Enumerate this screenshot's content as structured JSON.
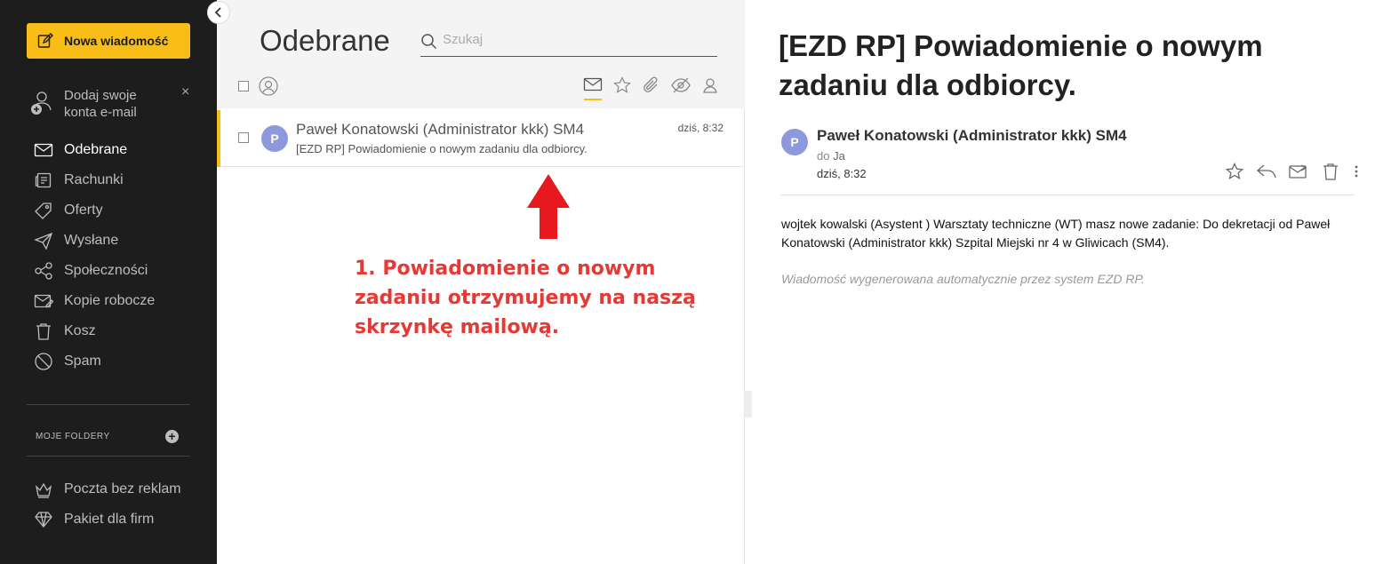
{
  "sidebar": {
    "compose_label": "Nowa wiadomość",
    "add_accounts_label_line1": "Dodaj swoje",
    "add_accounts_label_line2": "konta e-mail",
    "close_symbol": "×",
    "items": [
      {
        "label": "Odebrane",
        "icon": "envelope-icon",
        "active": true
      },
      {
        "label": "Rachunki",
        "icon": "bills-icon"
      },
      {
        "label": "Oferty",
        "icon": "tag-icon"
      },
      {
        "label": "Wysłane",
        "icon": "paper-plane-icon"
      },
      {
        "label": "Społeczności",
        "icon": "share-icon"
      },
      {
        "label": "Kopie robocze",
        "icon": "draft-icon"
      },
      {
        "label": "Kosz",
        "icon": "trash-icon"
      },
      {
        "label": "Spam",
        "icon": "spam-icon"
      }
    ],
    "folders_header": "MOJE FOLDERY",
    "promo": [
      {
        "label": "Poczta bez reklam",
        "icon": "crown-icon"
      },
      {
        "label": "Pakiet dla firm",
        "icon": "diamond-icon"
      }
    ]
  },
  "list": {
    "title": "Odebrane",
    "search_placeholder": "Szukaj",
    "filters": [
      "unread-filter-icon",
      "star-filter-icon",
      "attachment-filter-icon",
      "hidden-filter-icon",
      "contact-filter-icon"
    ],
    "messages": [
      {
        "avatar_letter": "P",
        "from": "Paweł Konatowski (Administrator kkk) SM4",
        "subject": "[EZD RP] Powiadomienie o nowym zadaniu dla odbiorcy.",
        "time": "dziś, 8:32"
      }
    ]
  },
  "annotation": {
    "text": "1. Powiadomienie o nowym zadaniu otrzymujemy na naszą skrzynkę mailową.",
    "color": "#e53935"
  },
  "reader": {
    "subject": "[EZD RP] Powiadomienie o nowym zadaniu dla odbiorcy.",
    "avatar_letter": "P",
    "from": "Paweł Konatowski (Administrator kkk) SM4",
    "to_prefix": "do",
    "to": "Ja",
    "date": "dziś, 8:32",
    "body": "wojtek kowalski (Asystent ) Warsztaty techniczne (WT) masz nowe zadanie: Do dekretacji od Paweł Konatowski (Administrator kkk) Szpital Miejski nr 4 w Gliwicach (SM4).",
    "footer": "Wiadomość wygenerowana automatycznie przez system EZD RP."
  },
  "colors": {
    "accent": "#f8bd16",
    "sidebar_bg": "#1d1d1d",
    "avatar_bg": "#8e98dc"
  }
}
